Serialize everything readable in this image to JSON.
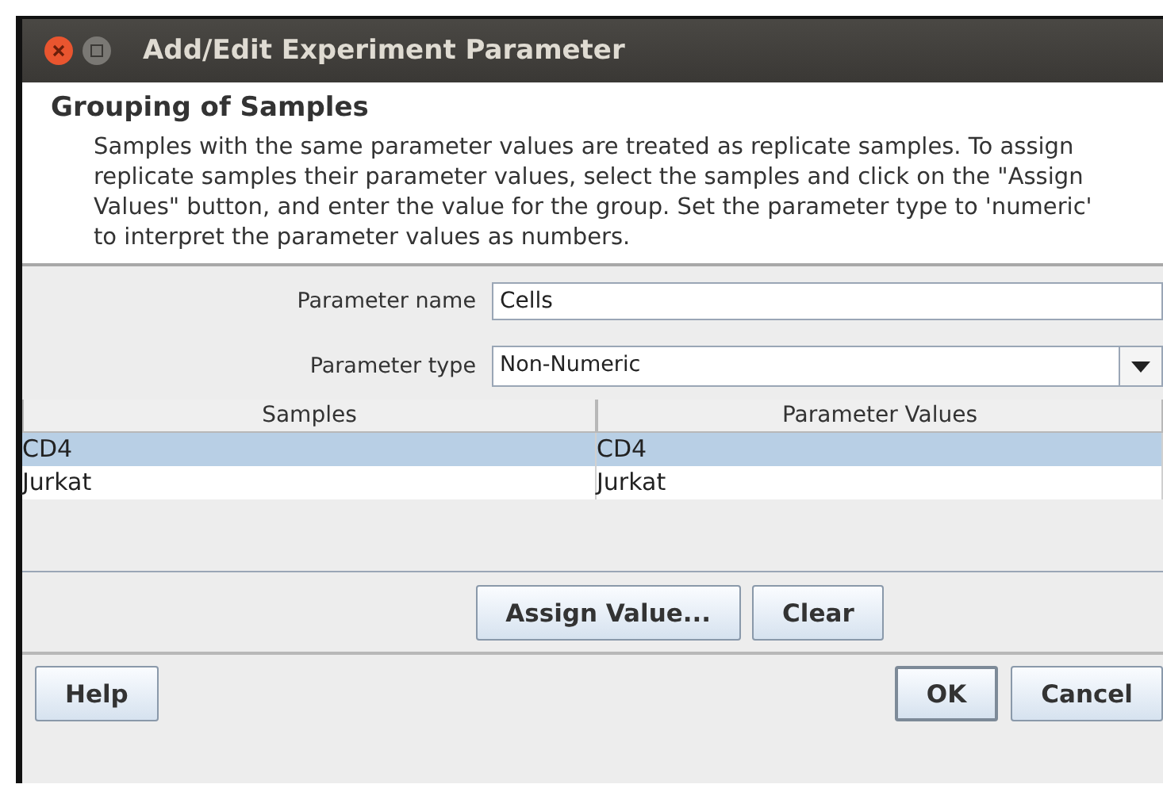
{
  "window": {
    "title": "Add/Edit Experiment Parameter"
  },
  "header": {
    "title": "Grouping of Samples",
    "description": "Samples with the same parameter values are treated as replicate samples. To assign replicate samples their parameter values, select the samples and click on the \"Assign Values\" button, and enter the value for the group. Set the parameter type to 'numeric' to interpret the parameter values as numbers."
  },
  "form": {
    "name_label": "Parameter name",
    "name_value": "Cells",
    "type_label": "Parameter type",
    "type_value": "Non-Numeric"
  },
  "table": {
    "columns": [
      "Samples",
      "Parameter Values"
    ],
    "rows": [
      {
        "cells": [
          "CD4",
          "CD4"
        ],
        "selected": true
      },
      {
        "cells": [
          "Jurkat",
          "Jurkat"
        ],
        "selected": false
      }
    ]
  },
  "table_buttons": [
    "Assign Value...",
    "Clear"
  ],
  "footer": {
    "help": "Help",
    "buttons": [
      {
        "label": "OK",
        "default": true
      },
      {
        "label": "Cancel",
        "default": false
      }
    ]
  }
}
